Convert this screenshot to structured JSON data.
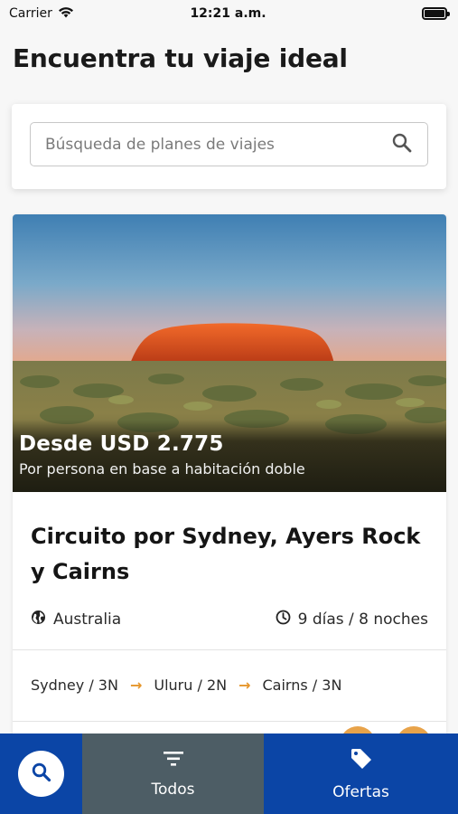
{
  "status_bar": {
    "carrier": "Carrier",
    "time": "12:21 a.m."
  },
  "page": {
    "title": "Encuentra tu viaje ideal"
  },
  "search": {
    "placeholder": "Búsqueda de planes de viajes"
  },
  "trip": {
    "image_subject": "Uluru at sunset, desert landscape",
    "price_label": "Desde USD 2.775",
    "price_note": "Por persona en base a habitación doble",
    "title": "Circuito por Sydney, Ayers Rock y Cairns",
    "country": "Australia",
    "duration": "9 días / 8 noches",
    "route": [
      {
        "stop": "Sydney / 3N"
      },
      {
        "stop": "Uluru / 2N"
      },
      {
        "stop": "Cairns / 3N"
      }
    ]
  },
  "tab_bar": {
    "search_icon": "search-icon",
    "tabs": [
      {
        "label": "Todos",
        "icon": "filter-icon",
        "active": true
      },
      {
        "label": "Ofertas",
        "icon": "tag-icon",
        "active": false
      }
    ]
  },
  "colors": {
    "tab_bar_blue": "#0b45a6",
    "tab_active_gray": "#4d5d65",
    "accent_orange": "#e6962b"
  }
}
